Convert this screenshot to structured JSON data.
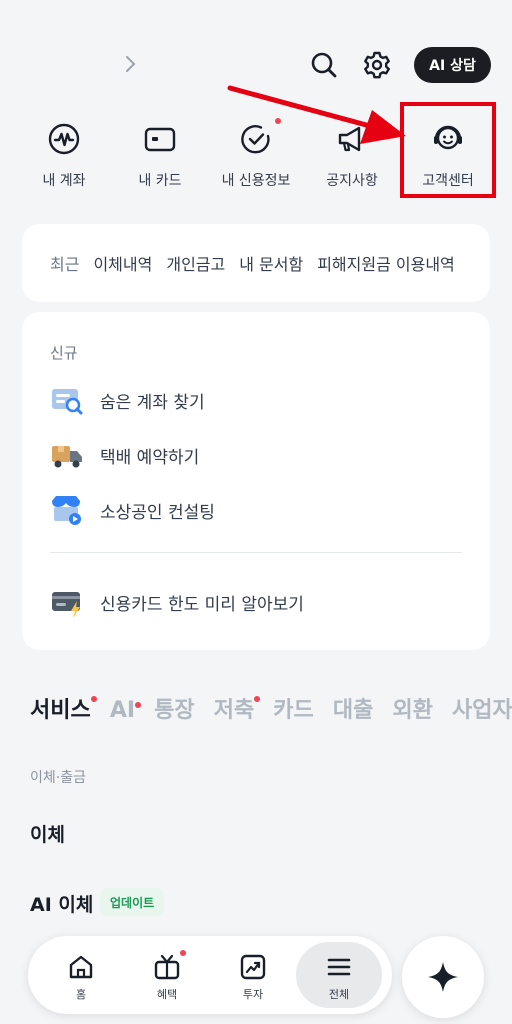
{
  "header": {
    "ai_button_label": "AI 상담"
  },
  "quick_menu": {
    "items": [
      {
        "label": "내 계좌",
        "icon": "account-wave-icon"
      },
      {
        "label": "내 카드",
        "icon": "card-icon"
      },
      {
        "label": "내 신용정보",
        "icon": "credit-check-icon",
        "has_dot": true
      },
      {
        "label": "공지사항",
        "icon": "megaphone-icon"
      },
      {
        "label": "고객센터",
        "icon": "headset-smile-icon"
      }
    ]
  },
  "recent": {
    "items": [
      "최근",
      "이체내역",
      "개인금고",
      "내 문서함",
      "피해지원금 이용내역"
    ]
  },
  "new_section": {
    "title": "신규",
    "items": [
      {
        "label": "숨은 계좌 찾기",
        "icon": "account-search-icon"
      },
      {
        "label": "택배 예약하기",
        "icon": "delivery-truck-icon"
      },
      {
        "label": "소상공인 컨설팅",
        "icon": "store-play-icon"
      }
    ],
    "extra": {
      "label": "신용카드 한도 미리 알아보기",
      "icon": "credit-card-bolt-icon"
    }
  },
  "tabs": {
    "items": [
      {
        "label": "서비스",
        "dot": true,
        "active": true
      },
      {
        "label": "AI",
        "dot": true
      },
      {
        "label": "통장"
      },
      {
        "label": "저축",
        "dot": true
      },
      {
        "label": "카드"
      },
      {
        "label": "대출"
      },
      {
        "label": "외환"
      },
      {
        "label": "사업자"
      }
    ]
  },
  "services": {
    "category": "이체·출금",
    "item1": "이체",
    "item2": "AI 이체",
    "badge": "업데이트"
  },
  "bottom_nav": {
    "items": [
      {
        "label": "홈",
        "icon": "home-icon"
      },
      {
        "label": "혜택",
        "icon": "tv-gift-icon",
        "has_dot": true
      },
      {
        "label": "투자",
        "icon": "chart-up-icon"
      },
      {
        "label": "전체",
        "icon": "menu-icon",
        "active": true
      }
    ]
  },
  "colors": {
    "highlight": "#e50012",
    "dot": "#f04452",
    "badge_bg": "#e8f6ee",
    "badge_text": "#1a9a55"
  }
}
